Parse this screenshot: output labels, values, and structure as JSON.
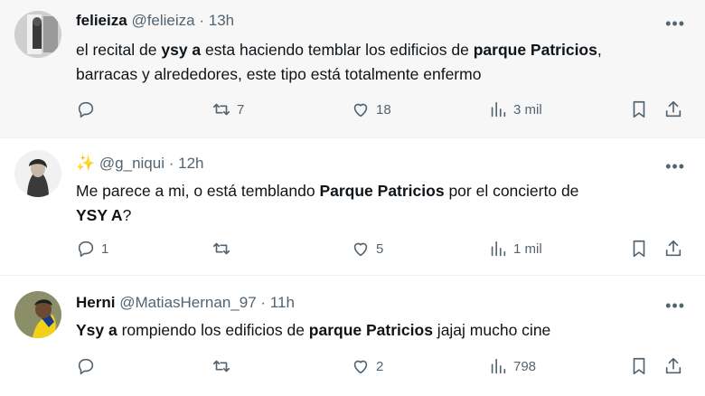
{
  "tweets": [
    {
      "name": "felieiza",
      "handle": "@felieiza",
      "dot": "·",
      "time": "13h",
      "more": "•••",
      "text_parts": [
        "el recital de ",
        "ysy a",
        " esta haciendo temblar los edificios de ",
        "parque Patricios",
        ",",
        "barracas y alrededores, este tipo está totalmente enfermo"
      ],
      "retweets": "7",
      "likes": "18",
      "views": "3 mil"
    },
    {
      "emoji": "✨",
      "handle": "@g_niqui",
      "dot": "·",
      "time": "12h",
      "more": "•••",
      "text_parts": [
        "Me parece a mi, o está temblando ",
        "Parque Patricios",
        " por el concierto de",
        "YSY A",
        "?"
      ],
      "replies": "1",
      "likes": "5",
      "views": "1 mil"
    },
    {
      "name": "Herni",
      "handle": "@MatiasHernan_97",
      "dot": "·",
      "time": "11h",
      "more": "•••",
      "text_parts": [
        "Ysy a",
        " rompiendo los edificios de ",
        "parque Patricios",
        " jajaj mucho cine"
      ],
      "likes": "2",
      "views": "798"
    }
  ]
}
